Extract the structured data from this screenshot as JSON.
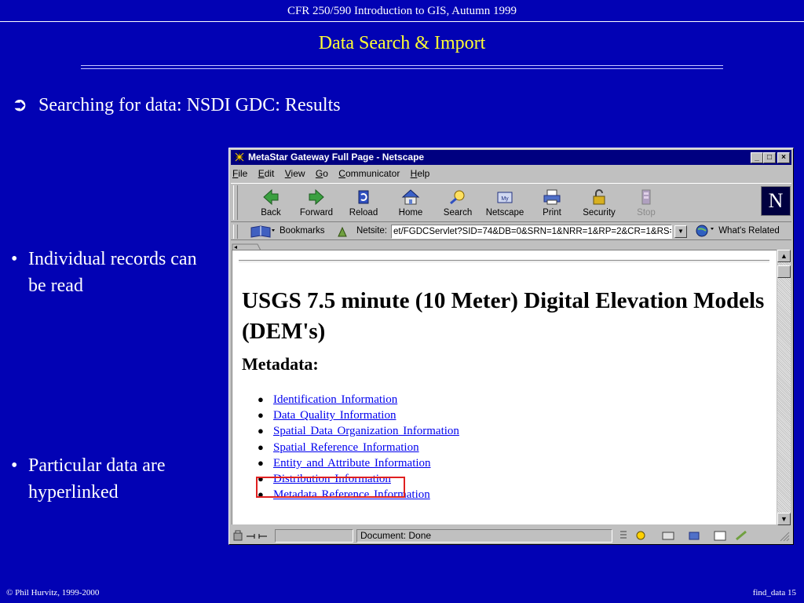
{
  "slide": {
    "header": "CFR 250/590 Introduction to GIS, Autumn 1999",
    "title": "Data Search  & Import",
    "main_bullet": "Searching for data: NSDI GDC: Results",
    "main_bullet_glyph": "➲",
    "side_bullets": [
      {
        "glyph": "•",
        "text": "Individual records can be read"
      },
      {
        "glyph": "•",
        "text": "Particular data are hyperlinked"
      }
    ],
    "footer_left": "© Phil Hurvitz, 1999-2000",
    "footer_right": "find_data 15"
  },
  "browser": {
    "title": "MetaStar Gateway Full Page - Netscape",
    "window_buttons": [
      "_",
      "□",
      "×"
    ],
    "menu": [
      {
        "key": "F",
        "rest": "ile"
      },
      {
        "key": "E",
        "rest": "dit"
      },
      {
        "key": "V",
        "rest": "iew"
      },
      {
        "key": "G",
        "rest": "o"
      },
      {
        "key": "C",
        "rest": "ommunicator"
      },
      {
        "key": "H",
        "rest": "elp"
      }
    ],
    "toolbar": [
      {
        "label": "Back",
        "icon": "back-arrow-icon"
      },
      {
        "label": "Forward",
        "icon": "forward-arrow-icon"
      },
      {
        "label": "Reload",
        "icon": "reload-icon"
      },
      {
        "label": "Home",
        "icon": "home-icon"
      },
      {
        "label": "Search",
        "icon": "search-icon"
      },
      {
        "label": "Netscape",
        "icon": "netscape-icon"
      },
      {
        "label": "Print",
        "icon": "print-icon"
      },
      {
        "label": "Security",
        "icon": "security-lock-icon"
      },
      {
        "label": "Stop",
        "icon": "stop-icon",
        "disabled": true
      }
    ],
    "logo": "N",
    "bookmarks_label": "Bookmarks",
    "netsite_label": "Netsite:",
    "url": "et/FGDCServlet?SID=74&DB=0&SRN=1&NRR=1&RP=2&CR=1&RS=F",
    "whats_related": "What's Related",
    "status": "Document: Done"
  },
  "page": {
    "heading": "USGS 7.5 minute (10 Meter) Digital Elevation Models (DEM's)",
    "metadata_heading": "Metadata:",
    "links": [
      "Identification Information",
      "Data Quality Information",
      "Spatial Data Organization Information",
      "Spatial Reference Information",
      "Entity and Attribute Information",
      "Distribution Information",
      "Metadata Reference Information"
    ],
    "highlighted_link": "Distribution Information",
    "highlight_color": "#e02020",
    "link_color": "#0000ee"
  },
  "colors": {
    "slide_background": "#0202b4",
    "title_color": "#ffff33",
    "titlebar": "#000080"
  }
}
